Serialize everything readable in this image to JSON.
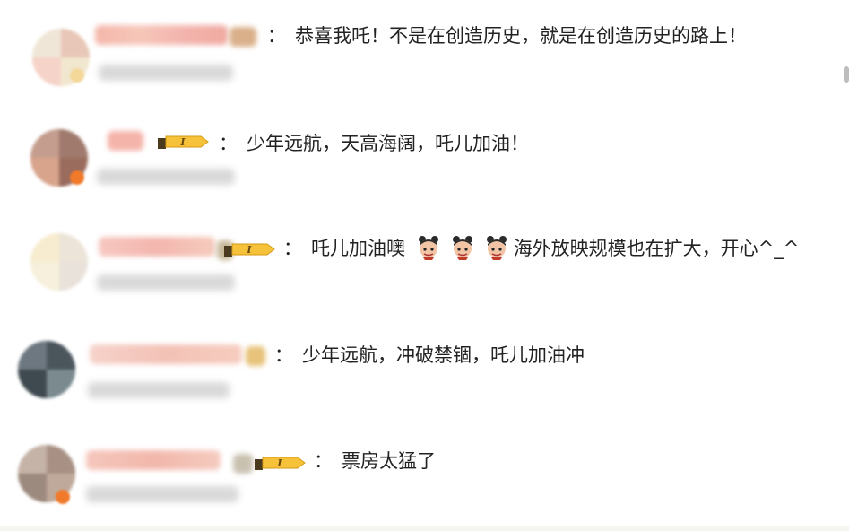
{
  "comments": [
    {
      "text": "恭喜我吒！不是在创造历史，就是在创造历史的路上！",
      "has_level_badge": false
    },
    {
      "text": "少年远航，天高海阔，吒儿加油！",
      "has_level_badge": true
    },
    {
      "text_before": "吒儿加油噢",
      "text_after": "海外放映规模也在扩大，开心^_^",
      "emoji_count": 3,
      "emoji_icon": "nezha-emoji-icon",
      "has_level_badge": true
    },
    {
      "text": "少年远航，冲破禁锢，吒儿加油冲",
      "has_level_badge": false
    },
    {
      "text": "票房太猛了",
      "has_level_badge": true
    }
  ],
  "separator": "：",
  "level_badge_text": "I",
  "colors": {
    "text": "#222222",
    "badge_gold": "#f6c23a",
    "badge_dark": "#4a3b1f",
    "verify_orange": "#f07a2a"
  }
}
